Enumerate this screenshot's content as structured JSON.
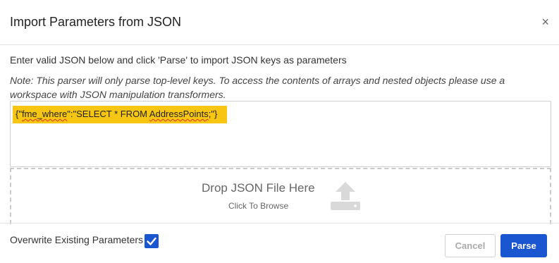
{
  "dialog": {
    "title": "Import Parameters from JSON",
    "close_glyph": "×"
  },
  "body": {
    "instructions": "Enter valid JSON below and click 'Parse' to import JSON keys as parameters",
    "note": "Note: This parser will only parse top-level keys. To access the contents of arrays and nested objects please use a workspace with JSON manipulation transformers."
  },
  "json_input": {
    "value_parts": [
      "{\"",
      "fme_where",
      "\":\"SELECT * FROM ",
      "AddressPoints",
      ";\"}"
    ],
    "highlight_color": "#f7c613"
  },
  "dropzone": {
    "title": "Drop JSON File Here",
    "subtitle": "Click To Browse",
    "icon": "upload-icon"
  },
  "footer": {
    "overwrite_label": "Overwrite Existing Parameters",
    "overwrite_checked": true,
    "cancel_label": "Cancel",
    "parse_label": "Parse"
  },
  "colors": {
    "accent": "#1b56d1",
    "highlight": "#f7c613",
    "spellcheck": "#e03131"
  }
}
